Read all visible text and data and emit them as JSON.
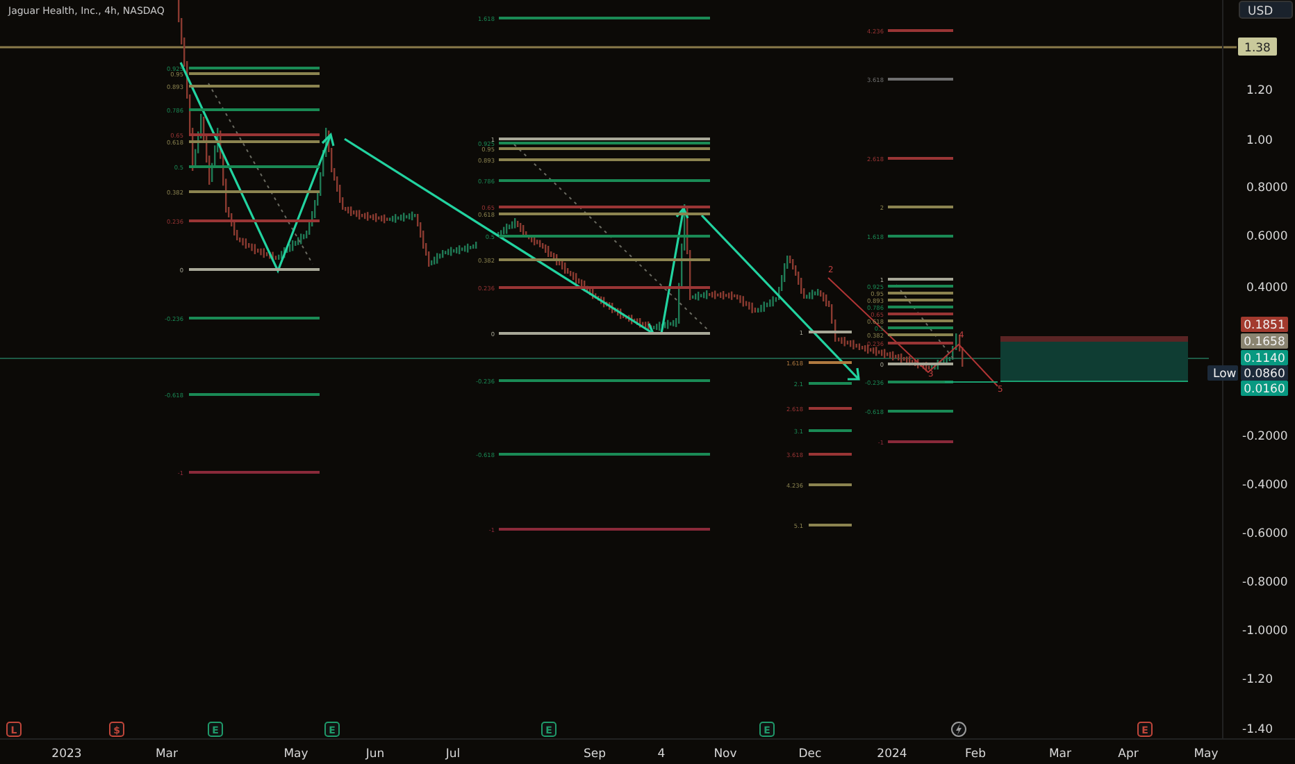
{
  "title": "Jaguar Health, Inc., 4h, NASDAQ",
  "currency": "USD",
  "price_ticks_upper": [
    "1.20",
    "1.00",
    "0.8000",
    "0.6000",
    "0.4000"
  ],
  "price_ticks_lower": [
    "-0.2000",
    "-0.4000",
    "-0.6000",
    "-0.8000",
    "-1.0000",
    "-1.20",
    "-1.40"
  ],
  "line_tag": {
    "label": "1.38",
    "color": "#c9c99b"
  },
  "price_tags": [
    {
      "label": "0.1851",
      "color": "#a33a2e"
    },
    {
      "label": "0.1658",
      "color": "#8a8470"
    },
    {
      "label": "0.1140",
      "color": "#089981"
    },
    {
      "label": "0.0860",
      "color": "#1c2a3a",
      "caption": "Low"
    },
    {
      "label": "0.0160",
      "color": "#089981"
    }
  ],
  "fib_tools": [
    {
      "levels": [
        {
          "label": "0.925",
          "color": "#1a8a55"
        },
        {
          "label": "0.95",
          "color": "#8c8450"
        },
        {
          "label": "0.893",
          "color": "#8c8450"
        },
        {
          "label": "0.786",
          "color": "#1a8a55"
        },
        {
          "label": "0.65",
          "color": "#9a3535"
        },
        {
          "label": "0.618",
          "color": "#8c8450"
        },
        {
          "label": "0.5",
          "color": "#1a8a55"
        },
        {
          "label": "0.382",
          "color": "#8c8450"
        },
        {
          "label": "0.236",
          "color": "#9a3535"
        },
        {
          "label": "0",
          "color": "#a8a898"
        },
        {
          "label": "-0.236",
          "color": "#1a8a55"
        },
        {
          "label": "-0.618",
          "color": "#1a8a55"
        },
        {
          "label": "-1",
          "color": "#8a2a3a"
        }
      ]
    },
    {
      "levels": [
        {
          "label": "1.618",
          "color": "#1a8a55"
        },
        {
          "label": "1",
          "color": "#a8a898"
        },
        {
          "label": "0.925",
          "color": "#1a8a55"
        },
        {
          "label": "0.95",
          "color": "#8c8450"
        },
        {
          "label": "0.893",
          "color": "#8c8450"
        },
        {
          "label": "0.786",
          "color": "#1a8a55"
        },
        {
          "label": "0.65",
          "color": "#9a3535"
        },
        {
          "label": "0.618",
          "color": "#8c8450"
        },
        {
          "label": "0.5",
          "color": "#1a8a55"
        },
        {
          "label": "0.382",
          "color": "#8c8450"
        },
        {
          "label": "0.236",
          "color": "#9a3535"
        },
        {
          "label": "0",
          "color": "#a8a898"
        },
        {
          "label": "-0.236",
          "color": "#1a8a55"
        },
        {
          "label": "-0.618",
          "color": "#1a8a55"
        },
        {
          "label": "-1",
          "color": "#8a2a3a"
        }
      ]
    },
    {
      "levels": [
        {
          "label": "4.236",
          "color": "#9a3535"
        },
        {
          "label": "3.618",
          "color": "#707070"
        },
        {
          "label": "2.618",
          "color": "#9a3535"
        },
        {
          "label": "2",
          "color": "#8c8450"
        },
        {
          "label": "1.618",
          "color": "#1a8a55"
        },
        {
          "label": "1",
          "color": "#a8a898"
        },
        {
          "label": "0.925",
          "color": "#1a8a55"
        },
        {
          "label": "0.95",
          "color": "#8c8450"
        },
        {
          "label": "0.893",
          "color": "#8c8450"
        },
        {
          "label": "0.786",
          "color": "#1a8a55"
        },
        {
          "label": "0.65",
          "color": "#9a3535"
        },
        {
          "label": "0.618",
          "color": "#8c8450"
        },
        {
          "label": "0.5",
          "color": "#1a8a55"
        },
        {
          "label": "0.382",
          "color": "#8c8450"
        },
        {
          "label": "0.236",
          "color": "#9a3535"
        },
        {
          "label": "0",
          "color": "#a8a898"
        },
        {
          "label": "-0.236",
          "color": "#1a8a55"
        },
        {
          "label": "-0.618",
          "color": "#1a8a55"
        },
        {
          "label": "-1",
          "color": "#8a2a3a"
        }
      ]
    },
    {
      "levels": [
        {
          "label": "1",
          "color": "#a8a898"
        },
        {
          "label": "1.618",
          "color": "#b07a40"
        },
        {
          "label": "2.1",
          "color": "#1a8a55"
        },
        {
          "label": "2.618",
          "color": "#9a3535"
        },
        {
          "label": "3.1",
          "color": "#1a8a55"
        },
        {
          "label": "3.618",
          "color": "#9a3535"
        },
        {
          "label": "4.236",
          "color": "#8c8450"
        },
        {
          "label": "5.1",
          "color": "#8c8450"
        }
      ]
    }
  ],
  "wave_labels": [
    "2",
    "3",
    "4",
    "5"
  ],
  "event_markers": [
    {
      "kind": "letter",
      "label": "L",
      "color": "#c0463a"
    },
    {
      "kind": "letter",
      "label": "$",
      "color": "#c0463a"
    },
    {
      "kind": "letter",
      "label": "E",
      "color": "#1f9a6a"
    },
    {
      "kind": "letter",
      "label": "E",
      "color": "#1f9a6a"
    },
    {
      "kind": "letter",
      "label": "E",
      "color": "#1f9a6a"
    },
    {
      "kind": "letter",
      "label": "E",
      "color": "#1f9a6a"
    },
    {
      "kind": "flash",
      "color": "#9a9a9a"
    },
    {
      "kind": "letter",
      "label": "E",
      "color": "#c0463a"
    }
  ],
  "time_axis": [
    "2023",
    "Mar",
    "May",
    "Jun",
    "Jul",
    "Sep",
    "4",
    "Nov",
    "Dec",
    "2024",
    "Feb",
    "Mar",
    "Apr",
    "May"
  ]
}
